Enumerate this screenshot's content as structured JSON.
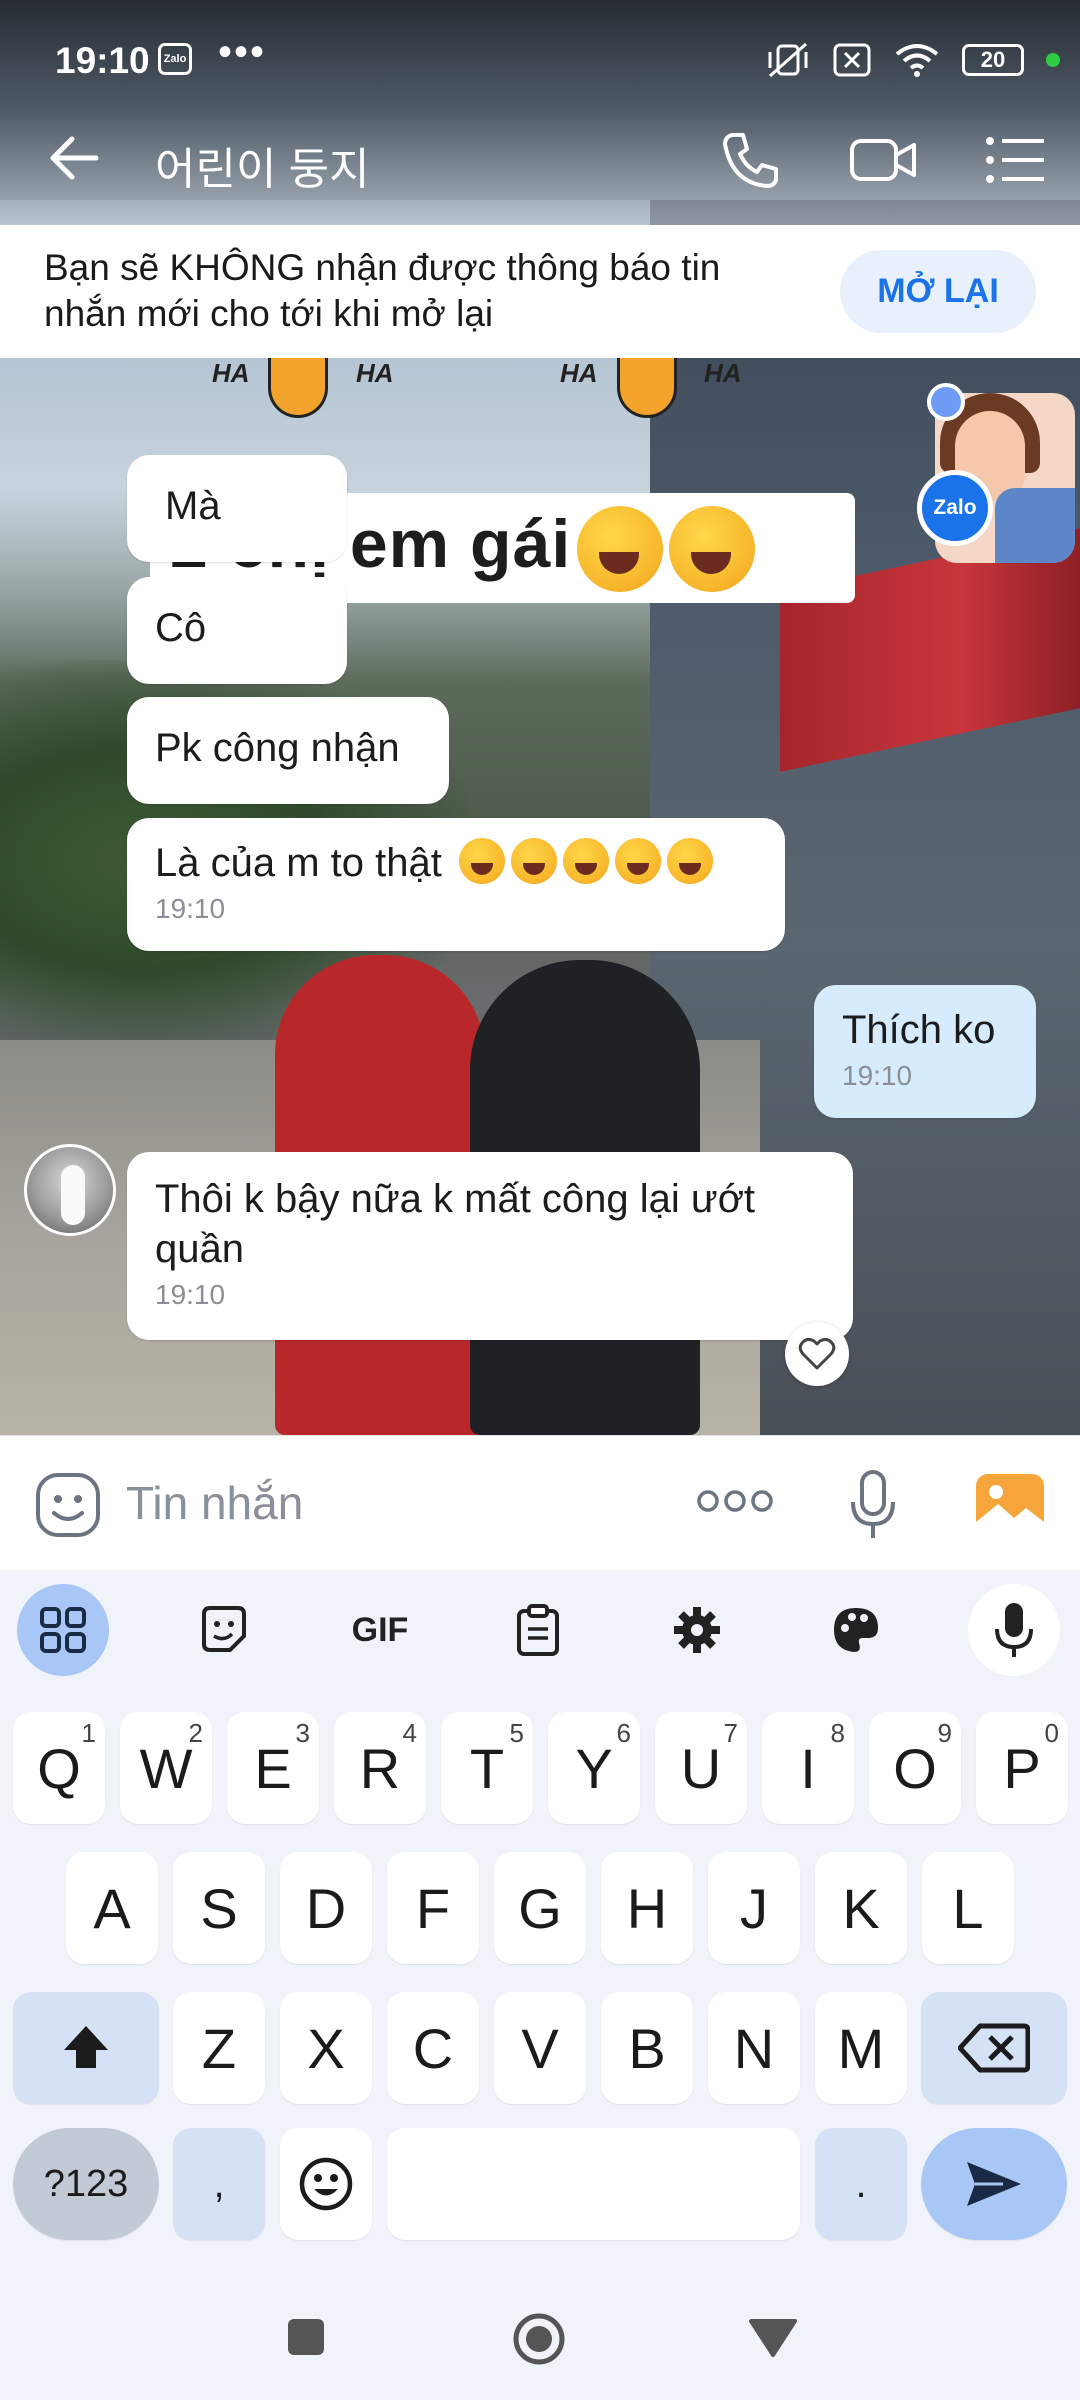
{
  "status": {
    "time": "19:10",
    "zalo_badge": "Zalo",
    "dots": "•••",
    "battery": "20"
  },
  "header": {
    "title": "어린이 둥지"
  },
  "notice": {
    "text": "Bạn sẽ KHÔNG nhận được thông báo tin nhắn mới cho tới khi mở lại",
    "button": "MỞ LẠI"
  },
  "sticker": {
    "ha1": "HA",
    "ha2": "HA",
    "ha3": "HA",
    "ha4": "HA",
    "banner_text": "2 chị em gái"
  },
  "chathead": {
    "badge": "Zalo"
  },
  "messages": [
    {
      "text": "Mà",
      "time": ""
    },
    {
      "text": "Cô",
      "time": ""
    },
    {
      "text": "Pk công nhận",
      "time": ""
    },
    {
      "text": "Là của m to thật",
      "time": "19:10"
    },
    {
      "text": "Thích ko",
      "time": "19:10"
    },
    {
      "text": "Thôi k bậy nữa  k mất công lại ướt quần",
      "time": "19:10"
    }
  ],
  "composer": {
    "placeholder": "Tin nhắn"
  },
  "keyboard": {
    "toolbar": [
      "apps",
      "sticker",
      "GIF",
      "clipboard",
      "settings",
      "theme",
      "voice"
    ],
    "row1": [
      {
        "k": "Q",
        "n": "1"
      },
      {
        "k": "W",
        "n": "2"
      },
      {
        "k": "E",
        "n": "3"
      },
      {
        "k": "R",
        "n": "4"
      },
      {
        "k": "T",
        "n": "5"
      },
      {
        "k": "Y",
        "n": "6"
      },
      {
        "k": "U",
        "n": "7"
      },
      {
        "k": "I",
        "n": "8"
      },
      {
        "k": "O",
        "n": "9"
      },
      {
        "k": "P",
        "n": "0"
      }
    ],
    "row2": [
      "A",
      "S",
      "D",
      "F",
      "G",
      "H",
      "J",
      "K",
      "L"
    ],
    "row3": [
      "Z",
      "X",
      "C",
      "V",
      "B",
      "N",
      "M"
    ],
    "symbols": "?123",
    "comma": ",",
    "period": "."
  },
  "colors": {
    "accent": "#1a73e8",
    "outgoing_bubble": "#d6ebfb",
    "keyboard_bg": "#f0f3fa"
  }
}
